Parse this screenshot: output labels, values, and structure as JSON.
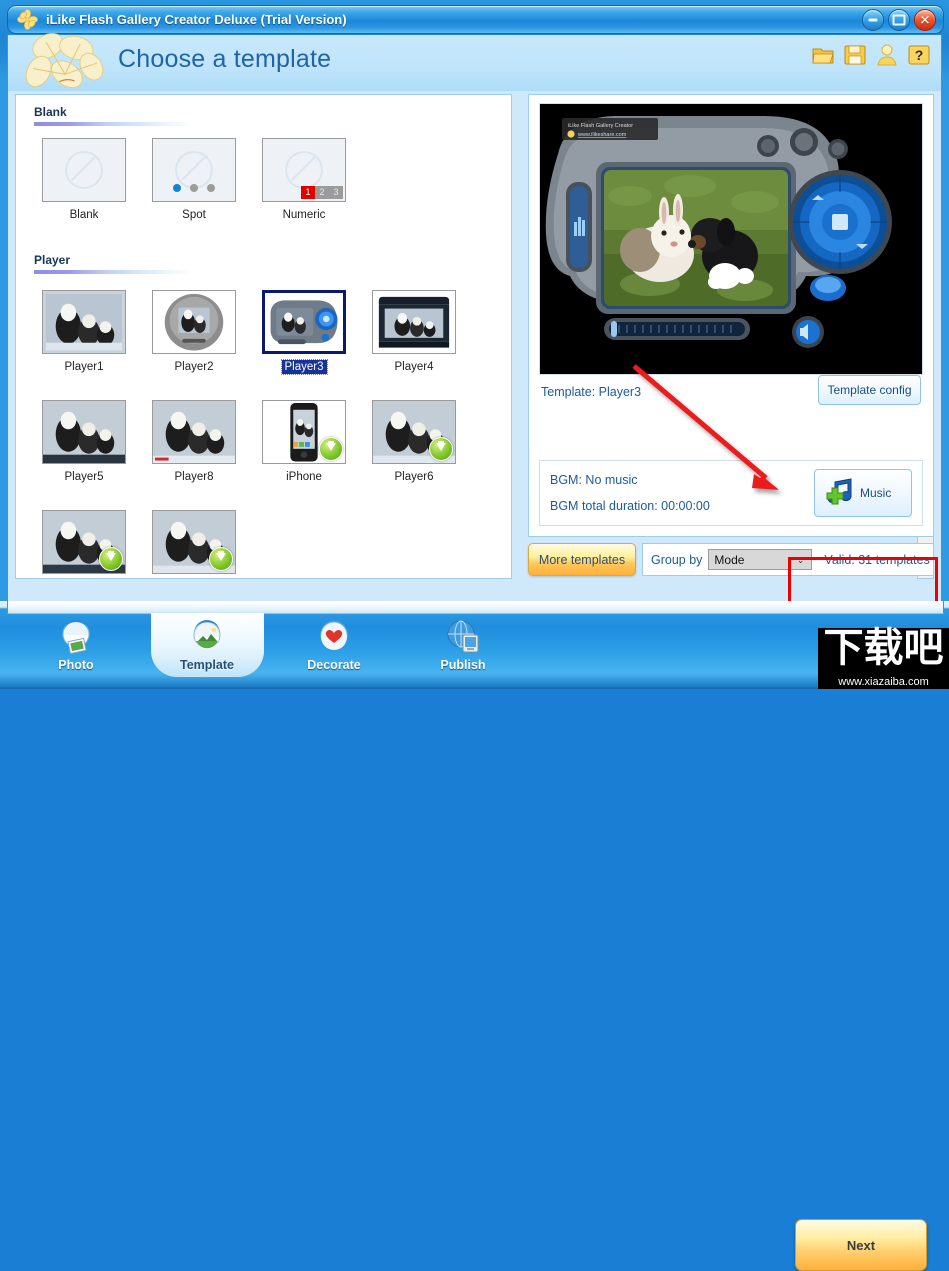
{
  "window": {
    "title": "iLike Flash Gallery Creator Deluxe (Trial Version)",
    "logo_icon": "flower-logo-icon",
    "minimize_label": "–",
    "maximize_label": "□",
    "close_label": "✕"
  },
  "header": {
    "page_title": "Choose a template",
    "flower_icon": "flower-logo-icon",
    "icons": [
      {
        "name": "open-folder-icon",
        "glyph": "📁"
      },
      {
        "name": "save-icon",
        "glyph": "💾"
      },
      {
        "name": "user-account-icon",
        "glyph": "👤"
      },
      {
        "name": "help-icon",
        "glyph": "?"
      }
    ]
  },
  "templates": {
    "sections": [
      {
        "title": "Blank",
        "items": [
          {
            "label": "Blank",
            "kind": "blank",
            "selected": false,
            "badge": false
          },
          {
            "label": "Spot",
            "kind": "spot",
            "selected": false,
            "badge": false
          },
          {
            "label": "Numeric",
            "kind": "numeric",
            "selected": false,
            "badge": false
          }
        ]
      },
      {
        "title": "Player",
        "items": [
          {
            "label": "Player1",
            "kind": "photo",
            "selected": false,
            "badge": false
          },
          {
            "label": "Player2",
            "kind": "photo",
            "selected": false,
            "badge": false
          },
          {
            "label": "Player3",
            "kind": "photo",
            "selected": true,
            "badge": false
          },
          {
            "label": "Player4",
            "kind": "photo",
            "selected": false,
            "badge": false
          },
          {
            "label": "Player5",
            "kind": "photo",
            "selected": false,
            "badge": false
          },
          {
            "label": "Player8",
            "kind": "photo",
            "selected": false,
            "badge": false
          },
          {
            "label": "iPhone",
            "kind": "photo",
            "selected": false,
            "badge": true
          },
          {
            "label": "Player6",
            "kind": "photo",
            "selected": false,
            "badge": true
          },
          {
            "label": "",
            "kind": "photo",
            "selected": false,
            "badge": true
          },
          {
            "label": "",
            "kind": "photo",
            "selected": false,
            "badge": true
          }
        ]
      }
    ],
    "numeric_pages": [
      "1",
      "2",
      "3"
    ]
  },
  "scrollbar": {
    "up_arrow": "⌃",
    "down_arrow": "⌄"
  },
  "preview": {
    "watermark_line1": "iLike Flash Gallery Creator",
    "watermark_line2": "www.ilikeshare.com",
    "template_label": "Template:  Player3",
    "template_config_button": "Template config"
  },
  "bgm": {
    "music_line": "BGM: No music",
    "duration_line": "BGM total duration: 00:00:00",
    "music_button_label": "Music",
    "music_icon": "music-note-add-icon"
  },
  "footer_controls": {
    "more_templates_button": "More templates",
    "group_by_label": "Group by",
    "group_by_value": "Mode",
    "group_by_chevron": "⌄",
    "valid_text": "Valid: 31 templates"
  },
  "nav": {
    "items": [
      {
        "label": "Photo",
        "icon": "photo-globe-icon",
        "active": false
      },
      {
        "label": "Template",
        "icon": "template-globe-icon",
        "active": true
      },
      {
        "label": "Decorate",
        "icon": "heart-globe-icon",
        "active": false
      },
      {
        "label": "Publish",
        "icon": "publish-globe-icon",
        "active": false
      }
    ],
    "next_button": "Next"
  },
  "watermark": {
    "text_cn": "下载吧",
    "url": "www.xiazaiba.com"
  },
  "colors": {
    "accent_blue": "#2f9ae2",
    "title_blue": "#1c87d6",
    "header_band": "#bfe4fa",
    "selection_navy": "#0b1a6e",
    "annotation_red": "#ee0000",
    "badge_green": "#7cc327",
    "numeric_red": "#e00000",
    "yellow_button": "#ffb13c"
  }
}
